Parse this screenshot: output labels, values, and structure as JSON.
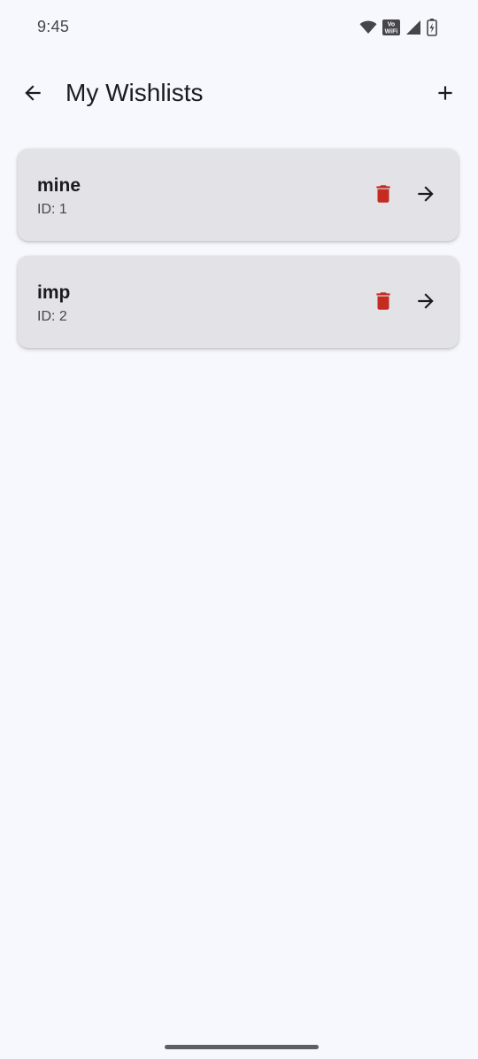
{
  "status_bar": {
    "time": "9:45",
    "vowifi_label_top": "Vo",
    "vowifi_label_bottom": "WiFi"
  },
  "app_bar": {
    "title": "My Wishlists"
  },
  "colors": {
    "background": "#f7f8fd",
    "card": "#e3e2e7",
    "delete": "#c42b21",
    "text": "#1b1b1f"
  },
  "wishlists": [
    {
      "name": "mine",
      "id_text": "ID: 1"
    },
    {
      "name": "imp",
      "id_text": "ID: 2"
    }
  ]
}
